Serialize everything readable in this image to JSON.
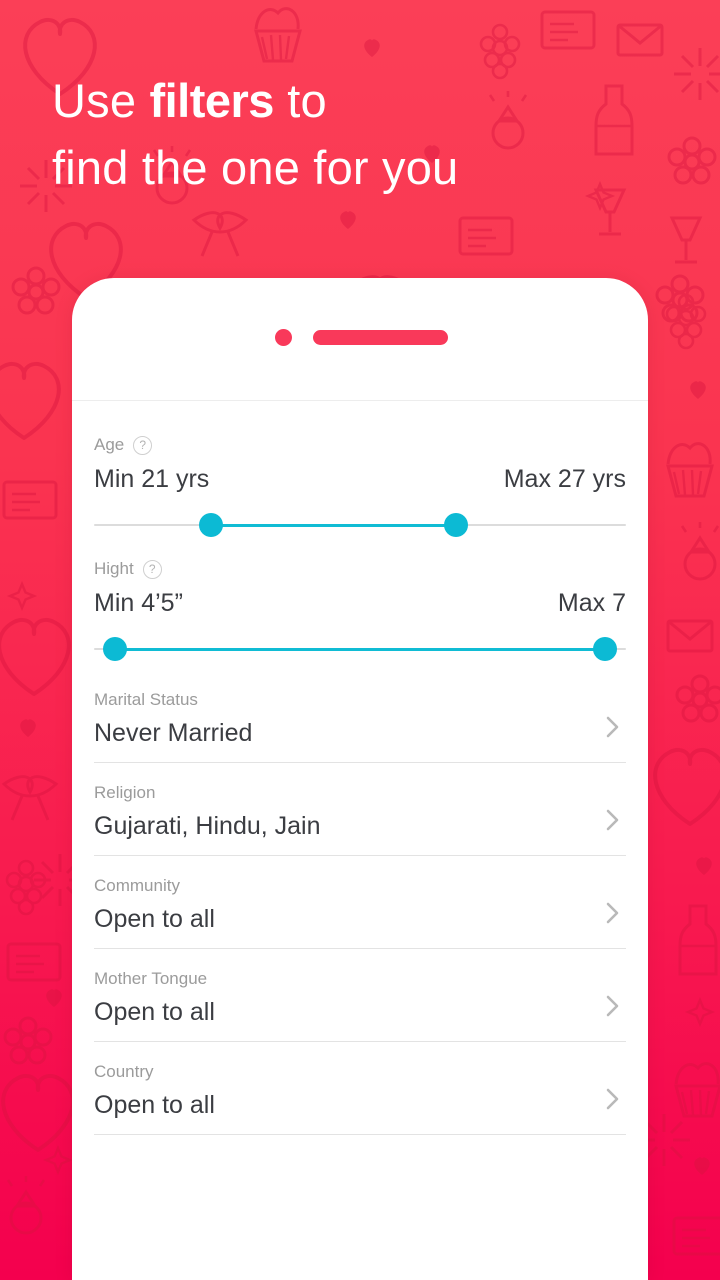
{
  "promo": {
    "headline_line1_prefix": "Use ",
    "headline_line1_strong": "filters",
    "headline_line1_suffix": " to",
    "headline_line2": "find the one for you",
    "background_color": "#fa3450",
    "background_color_bottom": "#f4004e"
  },
  "phone": {
    "camera_icon": "camera-dot",
    "speaker_icon": "speaker-bar",
    "accent_color": "#f9395a"
  },
  "filters": {
    "accent_color": "#0cbad4",
    "age": {
      "label": "Age",
      "help_icon": "question-mark-icon",
      "min_text": "Min 21 yrs",
      "max_text": "Max 27 yrs",
      "min_value": 21,
      "max_value": 27,
      "slider_min_percent": 22,
      "slider_max_percent": 68
    },
    "height": {
      "label": "Hight",
      "help_icon": "question-mark-icon",
      "min_text": "Min 4’5”",
      "max_text": "Max 7",
      "slider_min_percent": 4,
      "slider_max_percent": 96
    },
    "rows": [
      {
        "label": "Marital Status",
        "value": "Never Married",
        "chevron_icon": "chevron-right-icon"
      },
      {
        "label": "Religion",
        "value": "Gujarati, Hindu, Jain",
        "chevron_icon": "chevron-right-icon"
      },
      {
        "label": "Community",
        "value": "Open to all",
        "chevron_icon": "chevron-right-icon"
      },
      {
        "label": "Mother Tongue",
        "value": "Open to all",
        "chevron_icon": "chevron-right-icon"
      },
      {
        "label": "Country",
        "value": "Open to all",
        "chevron_icon": "chevron-right-icon"
      }
    ]
  }
}
